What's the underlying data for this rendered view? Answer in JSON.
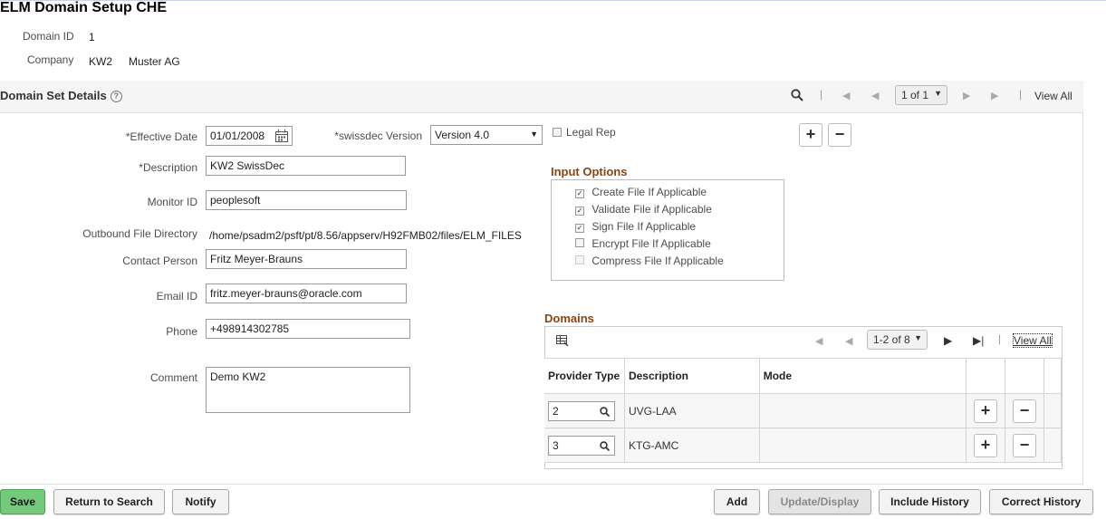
{
  "page": {
    "title": "ELM Domain Setup CHE"
  },
  "header": {
    "domain_id_label": "Domain ID",
    "domain_id": "1",
    "company_label": "Company",
    "company_code": "KW2",
    "company_name": "Muster AG"
  },
  "section": {
    "title": "Domain Set Details",
    "help": "?",
    "pager": "1 of 1",
    "view_all": "View All"
  },
  "form": {
    "effective_date_label": "*Effective Date",
    "effective_date": "01/01/2008",
    "swissdec_label": "*swissdec Version",
    "swissdec_value": "Version 4.0",
    "legal_rep_label": "Legal Rep",
    "description_label": "*Description",
    "description": "KW2 SwissDec",
    "monitor_label": "Monitor ID",
    "monitor": "peoplesoft",
    "outbound_label": "Outbound File Directory",
    "outbound": "/home/psadm2/psft/pt/8.56/appserv/H92FMB02/files/ELM_FILES",
    "contact_label": "Contact Person",
    "contact": "Fritz Meyer-Brauns",
    "email_label": "Email ID",
    "email": "fritz.meyer-brauns@oracle.com",
    "phone_label": "Phone",
    "phone": "+498914302785",
    "comment_label": "Comment",
    "comment": "Demo KW2"
  },
  "input_options": {
    "title": "Input Options",
    "items": [
      {
        "label": "Create File If Applicable",
        "checked": true
      },
      {
        "label": "Validate File if Applicable",
        "checked": true
      },
      {
        "label": "Sign File If Applicable",
        "checked": true
      },
      {
        "label": "Encrypt File If Applicable",
        "checked": false
      },
      {
        "label": "Compress File If Applicable",
        "checked": false
      }
    ]
  },
  "domains": {
    "title": "Domains",
    "pager": "1-2 of 8",
    "view_all": "View All",
    "columns": [
      "Provider Type",
      "Description",
      "Mode"
    ],
    "rows": [
      {
        "provider": "2",
        "description": "UVG-LAA",
        "mode": ""
      },
      {
        "provider": "3",
        "description": "KTG-AMC",
        "mode": ""
      }
    ]
  },
  "buttons": {
    "save": "Save",
    "return": "Return to Search",
    "notify": "Notify",
    "add": "Add",
    "update": "Update/Display",
    "include_history": "Include History",
    "correct_history": "Correct History"
  },
  "colors": {
    "group_title": "#8b4513",
    "save_button": "#74c97a"
  },
  "icons": [
    "search-icon",
    "first-icon",
    "prev-icon",
    "next-icon",
    "last-icon",
    "calendar-icon",
    "chevron-down-icon",
    "plus-icon",
    "minus-icon",
    "grid-personalize-icon"
  ]
}
